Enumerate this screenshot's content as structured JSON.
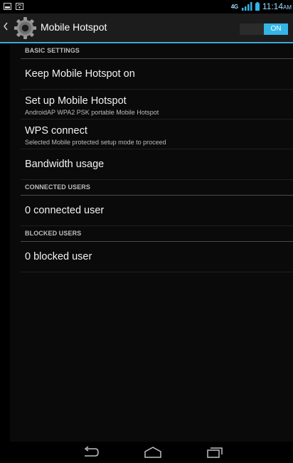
{
  "status_bar": {
    "network": "4G",
    "time": "11:14",
    "ampm": "AM"
  },
  "action_bar": {
    "title": "Mobile Hotspot",
    "toggle_label": "ON",
    "icon": "settings-gear-icon"
  },
  "sections": {
    "basic_settings": "BASIC SETTINGS",
    "connected_users": "CONNECTED USERS",
    "blocked_users": "BLOCKED USERS"
  },
  "items": {
    "keep_on": "Keep Mobile Hotspot on",
    "setup_title": "Set up Mobile Hotspot",
    "setup_summary": "AndroidAP WPA2 PSK portable Mobile Hotspot",
    "wps_title": "WPS connect",
    "wps_summary": "Selected Mobile protected setup mode to proceed",
    "bandwidth": "Bandwidth usage",
    "connected_count": "0 connected user",
    "blocked_count": "0 blocked user"
  },
  "colors": {
    "accent": "#33b5e5",
    "action_bar_bg": "#1c1c1c",
    "background": "#0a0a0a"
  }
}
